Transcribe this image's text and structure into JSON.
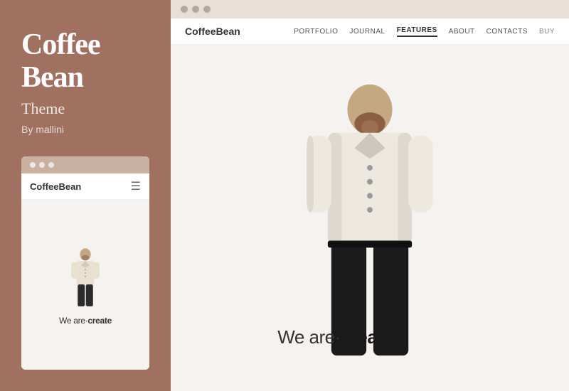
{
  "left": {
    "title_line1": "Coffee",
    "title_line2": "Bean",
    "subtitle": "Theme",
    "author": "By mallini",
    "mobile_preview": {
      "logo_light": "Coffee",
      "logo_bold": "Bean",
      "tagline_normal": "We are·",
      "tagline_bold": "create"
    }
  },
  "right": {
    "titlebar_dots": [
      "dot1",
      "dot2",
      "dot3"
    ],
    "nav": {
      "logo_light": "Coffee",
      "logo_bold": "Bean",
      "items": [
        {
          "label": "PORTFOLIO",
          "active": false
        },
        {
          "label": "JOURNAL",
          "active": false
        },
        {
          "label": "FEATURES",
          "active": true
        },
        {
          "label": "ABOUT",
          "active": false
        },
        {
          "label": "CONTACTS",
          "active": false
        },
        {
          "label": "BUY",
          "active": false
        }
      ]
    },
    "tagline_normal": "We are·",
    "tagline_bold": "create"
  },
  "colors": {
    "sidebar_bg": "#a07060",
    "titlebar_bg": "#c9b0a0",
    "desktop_titlebar_bg": "#e0d5cc"
  }
}
